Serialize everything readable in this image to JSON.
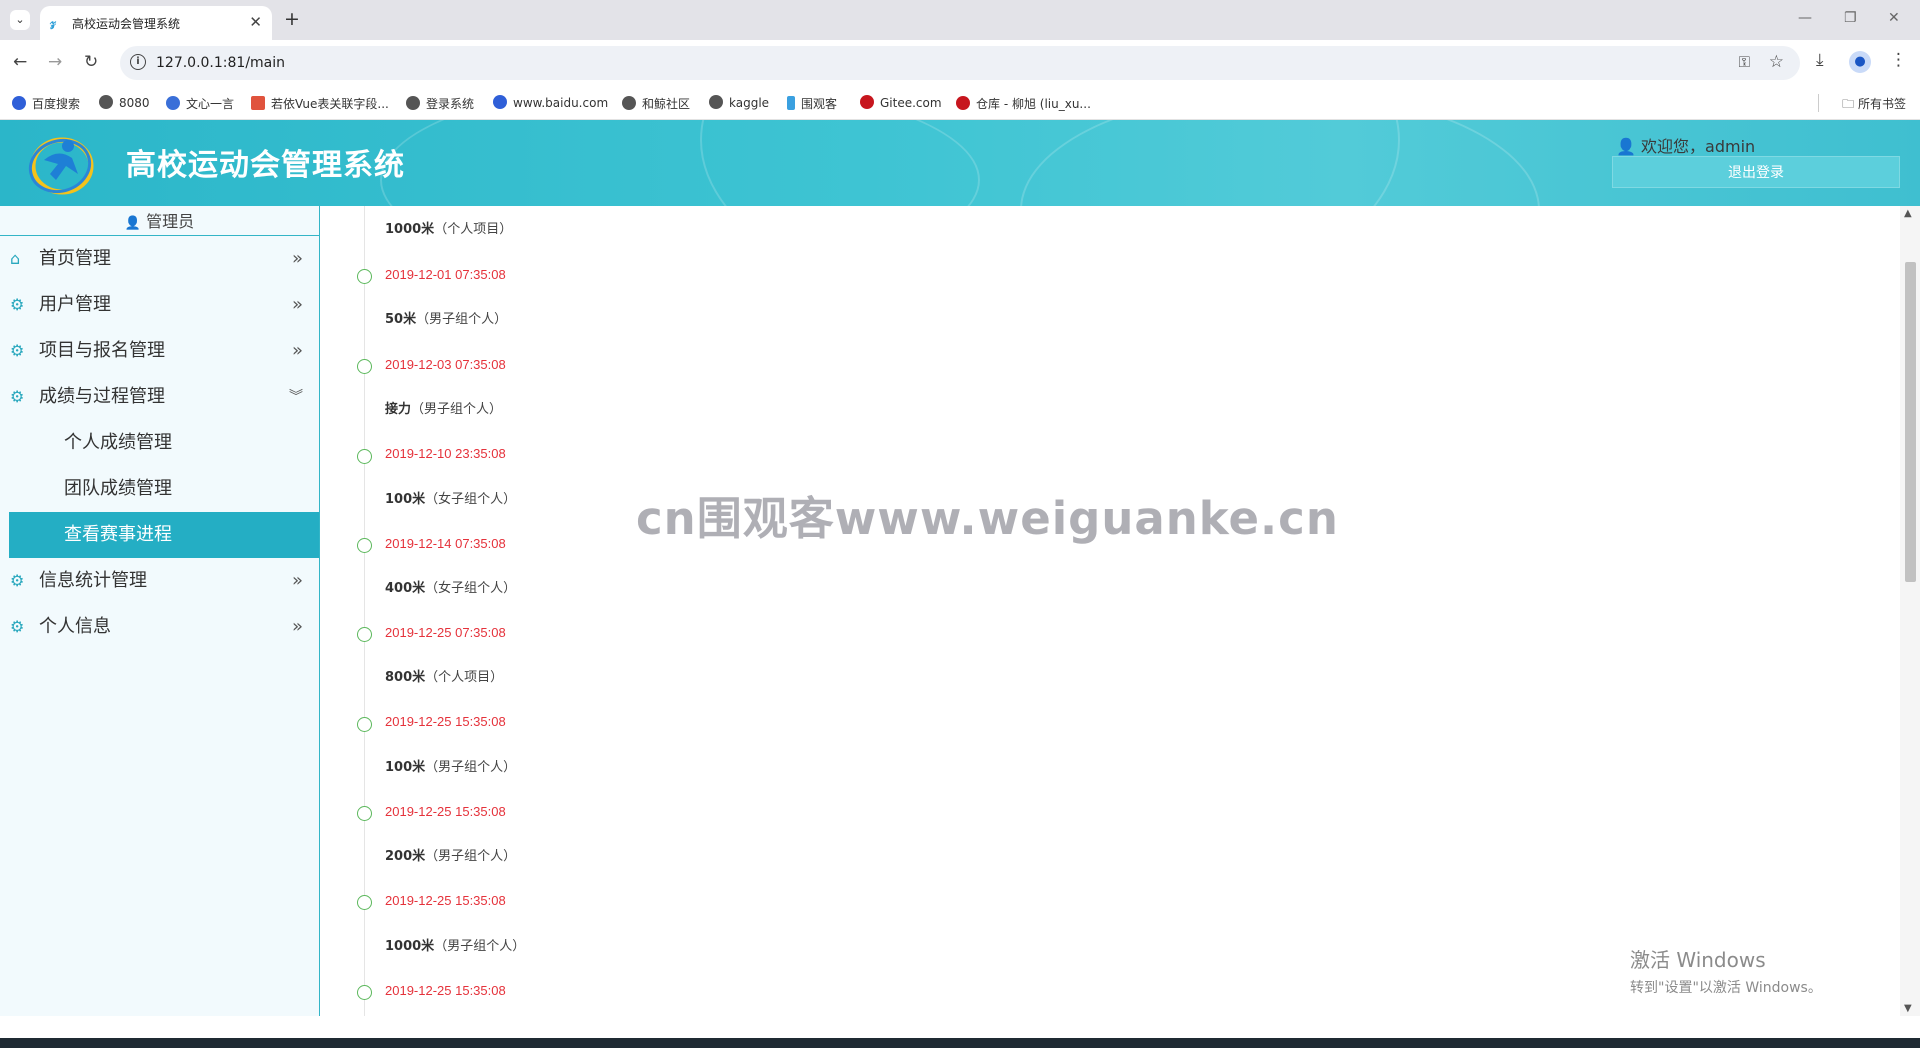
{
  "browser": {
    "tab_title": "高校运动会管理系统",
    "url": "127.0.0.1:81/main",
    "bookmarks": [
      {
        "label": "百度搜索",
        "color": "#2f5fd8"
      },
      {
        "label": "8080",
        "color": "#555555"
      },
      {
        "label": "文心一言",
        "color": "#3a6fd8"
      },
      {
        "label": "若依Vue表关联字段...",
        "color": "#e0533d"
      },
      {
        "label": "登录系统",
        "color": "#555555"
      },
      {
        "label": "www.baidu.com",
        "color": "#2f5fd8"
      },
      {
        "label": "和鲸社区",
        "color": "#555555"
      },
      {
        "label": "kaggle",
        "color": "#555555"
      },
      {
        "label": "围观客",
        "color": "#3aa0e0"
      },
      {
        "label": "Gitee.com",
        "color": "#c7161e"
      },
      {
        "label": "仓库 - 柳旭 (liu_xu...",
        "color": "#c7161e"
      }
    ],
    "all_bookmarks": "所有书签"
  },
  "header": {
    "title": "高校运动会管理系统",
    "welcome": "欢迎您，admin",
    "logout": "退出登录"
  },
  "sidebar": {
    "role": "管理员",
    "menu": [
      {
        "label": "首页管理",
        "icon": "home-icon",
        "arrow": "»"
      },
      {
        "label": "用户管理",
        "icon": "gear-icon",
        "arrow": "»"
      },
      {
        "label": "项目与报名管理",
        "icon": "gear-icon",
        "arrow": "»"
      },
      {
        "label": "成绩与过程管理",
        "icon": "gear-icon",
        "arrow": "︾"
      }
    ],
    "submenu": [
      {
        "label": "个人成绩管理"
      },
      {
        "label": "团队成绩管理"
      },
      {
        "label": "查看赛事进程",
        "active": true
      }
    ],
    "menu_after": [
      {
        "label": "信息统计管理",
        "icon": "gear-icon",
        "arrow": "»"
      },
      {
        "label": "个人信息",
        "icon": "gear-icon",
        "arrow": "»"
      }
    ]
  },
  "timeline": {
    "first_event": {
      "name": "1000米",
      "group": "（个人项目）"
    },
    "entries": [
      {
        "date": "2019-12-01 07:35:08",
        "name": "50米",
        "group": "（男子组个人）"
      },
      {
        "date": "2019-12-03 07:35:08",
        "name": "接力",
        "group": "（男子组个人）"
      },
      {
        "date": "2019-12-10 23:35:08",
        "name": "100米",
        "group": "（女子组个人）"
      },
      {
        "date": "2019-12-14 07:35:08",
        "name": "400米",
        "group": "（女子组个人）"
      },
      {
        "date": "2019-12-25 07:35:08",
        "name": "800米",
        "group": "（个人项目）"
      },
      {
        "date": "2019-12-25 15:35:08",
        "name": "100米",
        "group": "（男子组个人）"
      },
      {
        "date": "2019-12-25 15:35:08",
        "name": "200米",
        "group": "（男子组个人）"
      },
      {
        "date": "2019-12-25 15:35:08",
        "name": "1000米",
        "group": "（男子组个人）"
      },
      {
        "date": "2019-12-25 15:35:08",
        "name": "",
        "group": ""
      }
    ]
  },
  "watermark": "cn围观客www.weiguanke.cn",
  "activation": {
    "line1": "激活 Windows",
    "line2": "转到\"设置\"以激活 Windows。"
  },
  "colors": {
    "accent": "#24aec4",
    "date_red": "#e5323b",
    "dot_green": "#5cb85c"
  }
}
